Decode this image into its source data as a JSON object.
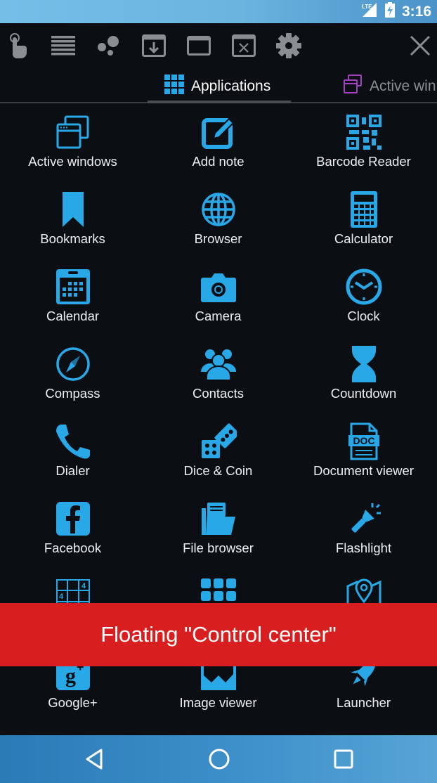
{
  "status_bar": {
    "network": "LTE",
    "time": "3:16"
  },
  "toolbar": {
    "icons": [
      "touch-icon",
      "list-icon",
      "bubbles-icon",
      "window-download-icon",
      "window-icon",
      "window-close-icon",
      "gear-icon"
    ],
    "close": "close-icon"
  },
  "tabs": [
    {
      "label": "Applications",
      "icon": "grid-icon",
      "active": true
    },
    {
      "label": "Active win",
      "icon": "windows-icon",
      "active": false
    }
  ],
  "apps": [
    {
      "label": "Active windows",
      "icon": "windows-icon"
    },
    {
      "label": "Add note",
      "icon": "note-edit-icon"
    },
    {
      "label": "Barcode Reader",
      "icon": "qr-code-icon"
    },
    {
      "label": "Bookmarks",
      "icon": "bookmark-icon"
    },
    {
      "label": "Browser",
      "icon": "globe-icon"
    },
    {
      "label": "Calculator",
      "icon": "calculator-icon"
    },
    {
      "label": "Calendar",
      "icon": "calendar-icon"
    },
    {
      "label": "Camera",
      "icon": "camera-icon"
    },
    {
      "label": "Clock",
      "icon": "clock-icon"
    },
    {
      "label": "Compass",
      "icon": "compass-icon"
    },
    {
      "label": "Contacts",
      "icon": "contacts-icon"
    },
    {
      "label": "Countdown",
      "icon": "hourglass-icon"
    },
    {
      "label": "Dialer",
      "icon": "phone-icon"
    },
    {
      "label": "Dice & Coin",
      "icon": "dice-icon"
    },
    {
      "label": "Document viewer",
      "icon": "doc-icon"
    },
    {
      "label": "Facebook",
      "icon": "facebook-icon"
    },
    {
      "label": "File browser",
      "icon": "folder-icon"
    },
    {
      "label": "Flashlight",
      "icon": "flashlight-icon"
    },
    {
      "label": "",
      "icon": "sudoku-icon"
    },
    {
      "label": "",
      "icon": "apps-grid-icon"
    },
    {
      "label": "",
      "icon": "map-icon"
    },
    {
      "label": "Google+",
      "icon": "google-plus-icon"
    },
    {
      "label": "Image viewer",
      "icon": "image-icon"
    },
    {
      "label": "Launcher",
      "icon": "rocket-icon"
    }
  ],
  "doc_icon_text": "DOC",
  "sudoku_digit": "4",
  "banner": {
    "text": "Floating \"Control center\""
  },
  "nav": {
    "back": "back-icon",
    "home": "home-icon",
    "recents": "recents-icon"
  },
  "colors": {
    "accent": "#29a8e8",
    "banner": "#d81e1e",
    "tab_secondary_icon": "#a33fc0"
  }
}
